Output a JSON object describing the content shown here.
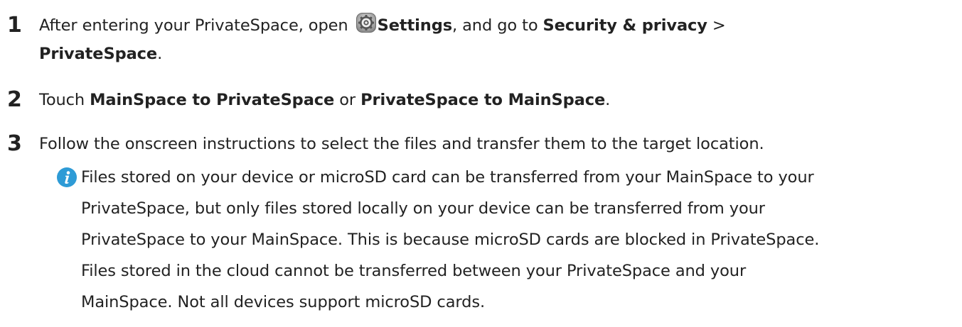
{
  "steps": [
    {
      "number": "1",
      "parts": {
        "a": "After entering your PrivateSpace, open ",
        "icon": "settings-gear-icon",
        "b": "Settings",
        "c": ", and go to ",
        "d": "Security & privacy",
        "e": " > ",
        "f": "PrivateSpace",
        "g": "."
      }
    },
    {
      "number": "2",
      "parts": {
        "a": "Touch ",
        "b": "MainSpace to PrivateSpace",
        "c": " or ",
        "d": "PrivateSpace to MainSpace",
        "e": "."
      }
    },
    {
      "number": "3",
      "text": "Follow the onscreen instructions to select the files and transfer them to the target location."
    }
  ],
  "note": {
    "icon": "info-icon",
    "icon_color": "#2e9bd6",
    "lines": [
      "Files stored on your device or microSD card can be transferred from your MainSpace to your",
      "PrivateSpace, but only files stored locally on your device can be transferred from your",
      "PrivateSpace to your MainSpace. This is because microSD cards are blocked in PrivateSpace.",
      "Files stored in the cloud cannot be transferred between your PrivateSpace and your",
      "MainSpace. Not all devices support microSD cards."
    ]
  }
}
